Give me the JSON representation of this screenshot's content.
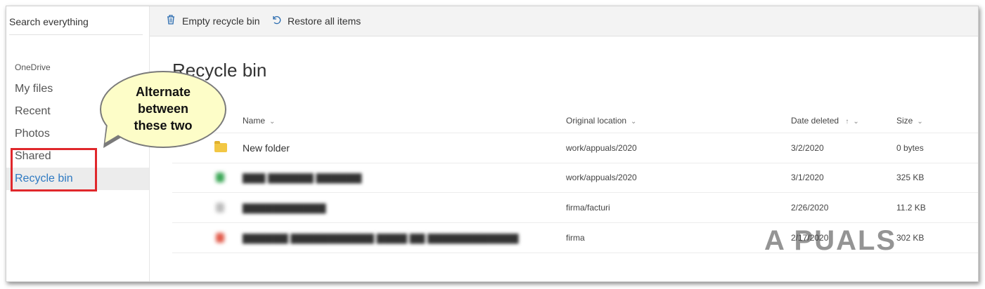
{
  "sidebar": {
    "search_placeholder": "Search everything",
    "group": "OneDrive",
    "items": [
      {
        "label": "My files"
      },
      {
        "label": "Recent"
      },
      {
        "label": "Photos"
      },
      {
        "label": "Shared"
      },
      {
        "label": "Recycle bin"
      }
    ]
  },
  "toolbar": {
    "empty_label": "Empty recycle bin",
    "restore_label": "Restore all items"
  },
  "main": {
    "title": "Recycle bin",
    "columns": {
      "name": "Name",
      "location": "Original location",
      "date": "Date deleted",
      "size": "Size"
    },
    "rows": [
      {
        "name": "New folder",
        "location": "work/appuals/2020",
        "date": "3/2/2020",
        "size": "0 bytes"
      },
      {
        "name": "",
        "location": "work/appuals/2020",
        "date": "3/1/2020",
        "size": "325 KB"
      },
      {
        "name": "",
        "location": "firma/facturi",
        "date": "2/26/2020",
        "size": "11.2 KB"
      },
      {
        "name": "",
        "location": "firma",
        "date": "2/17/2020",
        "size": "302 KB"
      }
    ]
  },
  "callout": {
    "line1": "Alternate",
    "line2": "between",
    "line3": "these two"
  },
  "watermark": "A  PUALS",
  "colors": {
    "accent": "#2f7ac2",
    "highlight": "#e0272b",
    "callout_fill": "#fdfdc8"
  }
}
